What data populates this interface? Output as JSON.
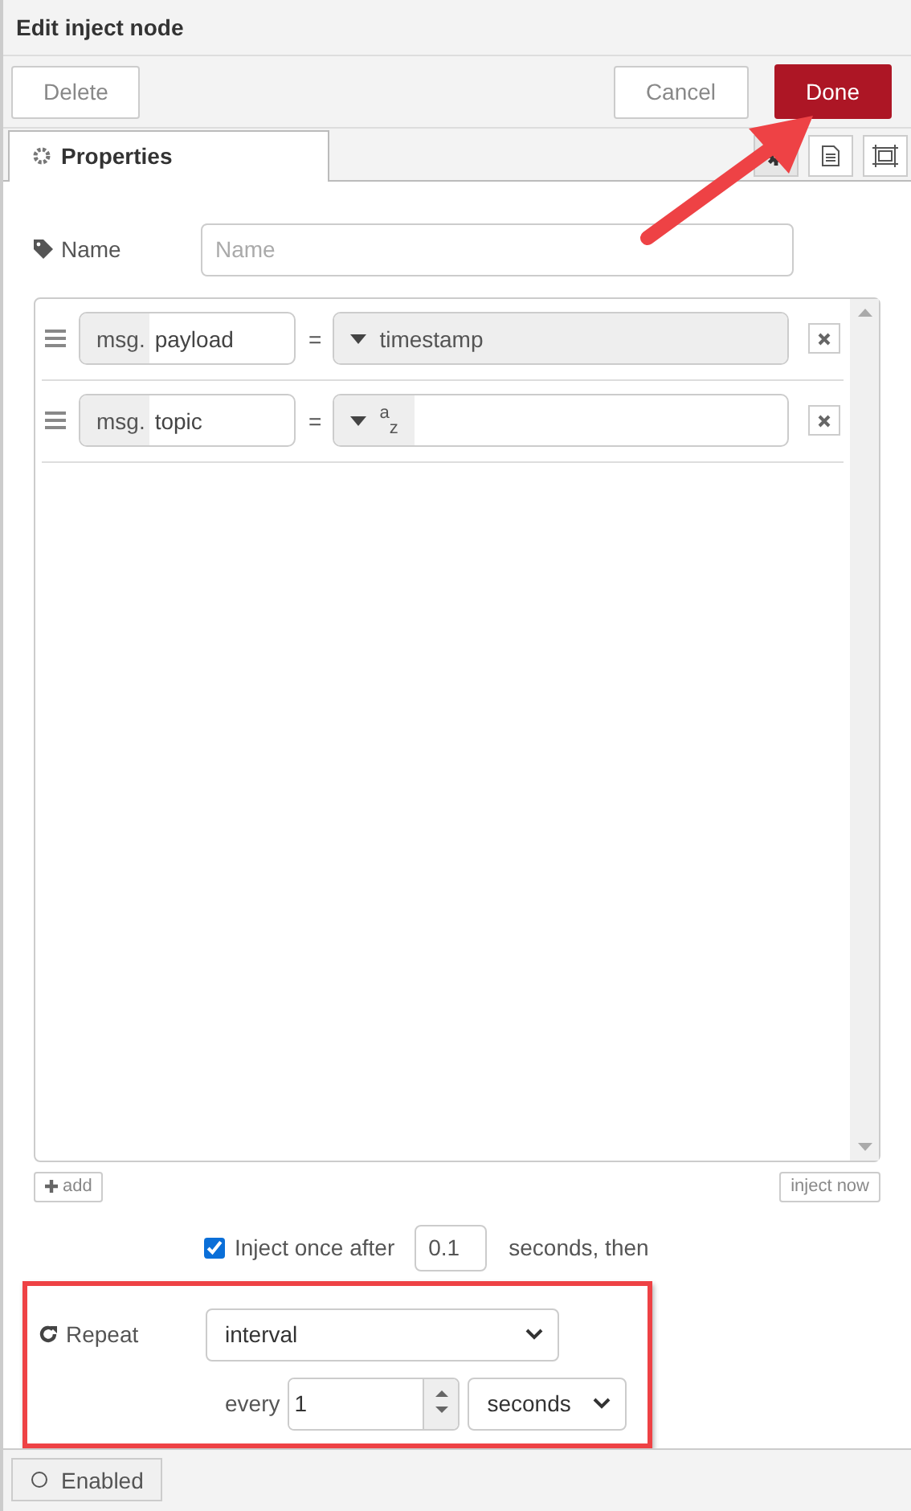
{
  "header": {
    "title": "Edit inject node"
  },
  "toolbar": {
    "buttons": [
      {
        "label": "Delete",
        "kind": "plain"
      },
      {
        "label": "Cancel",
        "kind": "plain"
      },
      {
        "label": "Done",
        "kind": "primary"
      }
    ]
  },
  "tabs": [
    {
      "label": "Properties",
      "selected": true
    }
  ],
  "side_tabs": [
    {
      "kind": "gear",
      "selected": true
    },
    {
      "kind": "doc",
      "selected": false
    },
    {
      "kind": "frame",
      "selected": false
    }
  ],
  "name_field": {
    "label": "Name",
    "placeholder": "Name"
  },
  "properties": [
    {
      "prefix": "msg.",
      "key": "payload",
      "operator": "=",
      "kind": "timestamp",
      "type_label": "timestamp"
    },
    {
      "prefix": "msg.",
      "key": "topic",
      "operator": "=",
      "kind": "string",
      "type_label": "$^{a}$$_{z}$"
    }
  ],
  "list_buttons": [
    {
      "label": "add",
      "kind": "add"
    },
    {
      "label": "inject now",
      "kind": "plain"
    }
  ],
  "inject_once": {
    "checked": true,
    "label": "Inject once after",
    "value": "0.1",
    "suffix": "seconds, then"
  },
  "repeat": {
    "label": "Repeat",
    "mode": "interval",
    "every_label": "every",
    "every_value": "1",
    "unit": "seconds"
  },
  "status_bar": {
    "label": "Enabled"
  }
}
